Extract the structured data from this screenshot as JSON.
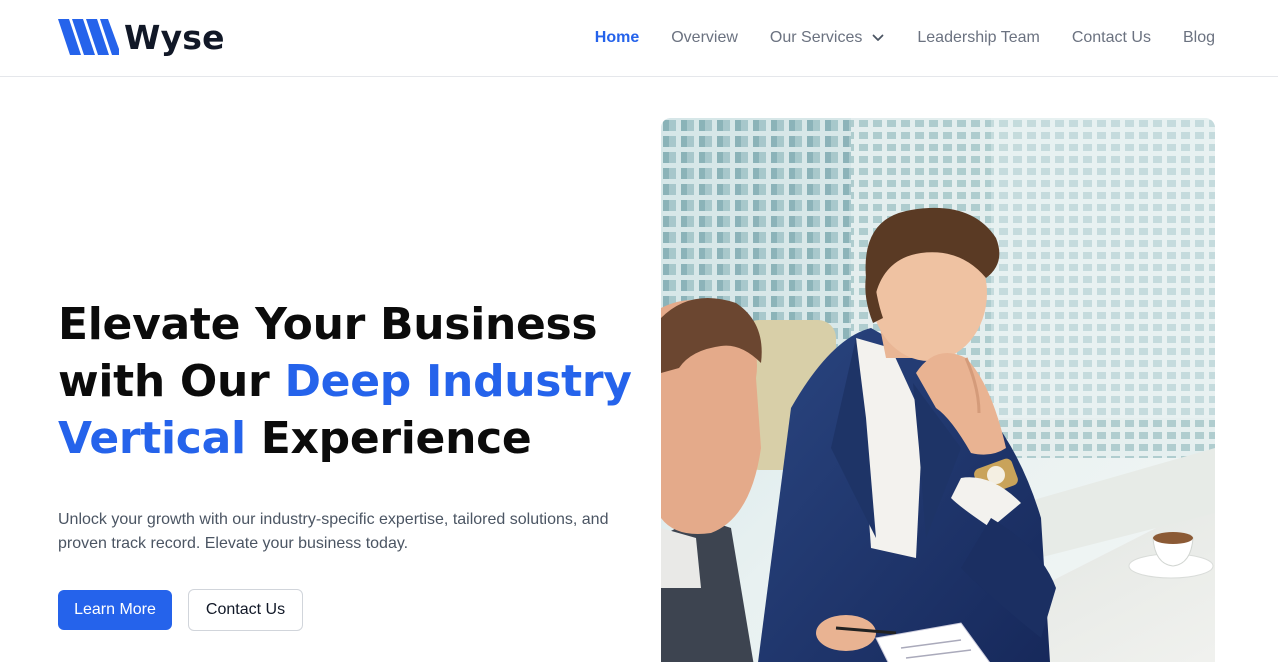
{
  "brand": {
    "name": "Wyse",
    "logo_icon": "wyse-logo-icon",
    "accent": "#2563eb"
  },
  "nav": {
    "items": [
      {
        "label": "Home",
        "active": true
      },
      {
        "label": "Overview",
        "active": false
      },
      {
        "label": "Our Services",
        "active": false,
        "icon": "chevron-down-icon"
      },
      {
        "label": "Leadership Team",
        "active": false
      },
      {
        "label": "Contact Us",
        "active": false
      },
      {
        "label": "Blog",
        "active": false
      }
    ]
  },
  "hero": {
    "title_part1": "Elevate Your Business with Our ",
    "title_highlight": "Deep Industry Vertical",
    "title_part2": " Experience",
    "subtitle": "Unlock your growth with our industry-specific expertise, tailored solutions, and proven track record. Elevate your business today.",
    "primary_button": "Learn More",
    "secondary_button": "Contact Us",
    "image": "business-meeting-photo"
  },
  "colors": {
    "text": "#0b0b0b",
    "muted": "#4b5563",
    "nav": "#6b7280",
    "border": "#e5e7eb"
  }
}
